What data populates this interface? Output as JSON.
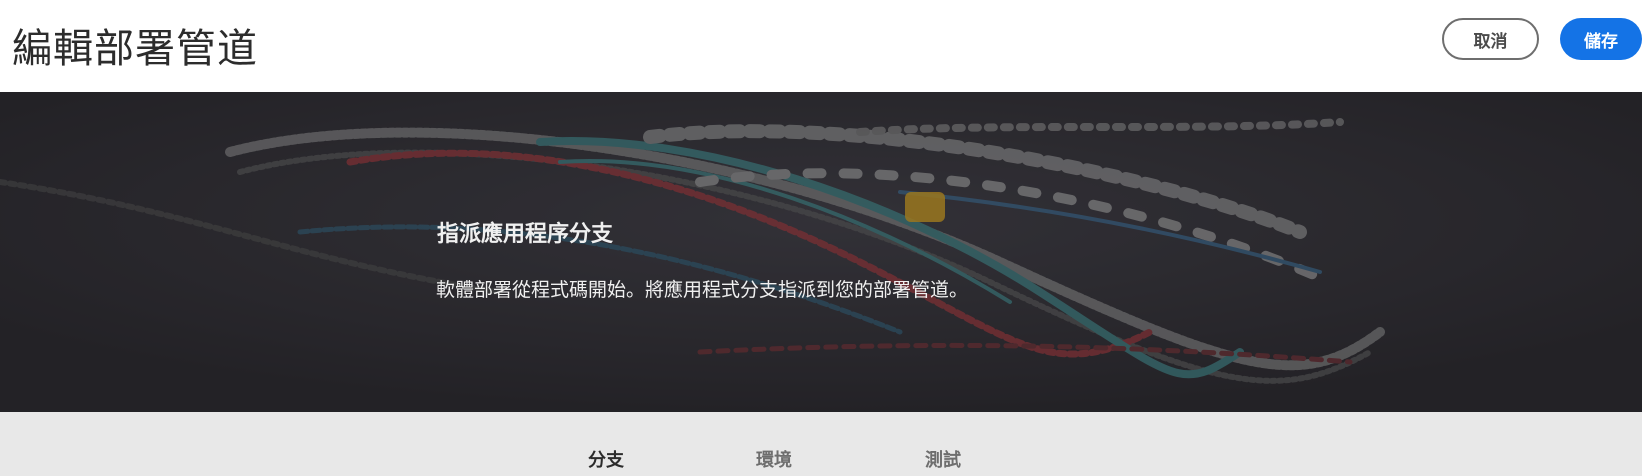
{
  "header": {
    "title": "編輯部署管道",
    "cancel_label": "取消",
    "save_label": "儲存"
  },
  "hero": {
    "heading": "指派應用程序分支",
    "description": "軟體部署從程式碼開始。將應用程式分支指派到您的部署管道。"
  },
  "tabs": [
    {
      "label": "分支",
      "active": true
    },
    {
      "label": "環境",
      "active": false
    },
    {
      "label": "測試",
      "active": false
    }
  ],
  "colors": {
    "primary_button": "#1473e6",
    "hero_background": "#262429",
    "tabs_background": "#e8e8e8"
  }
}
